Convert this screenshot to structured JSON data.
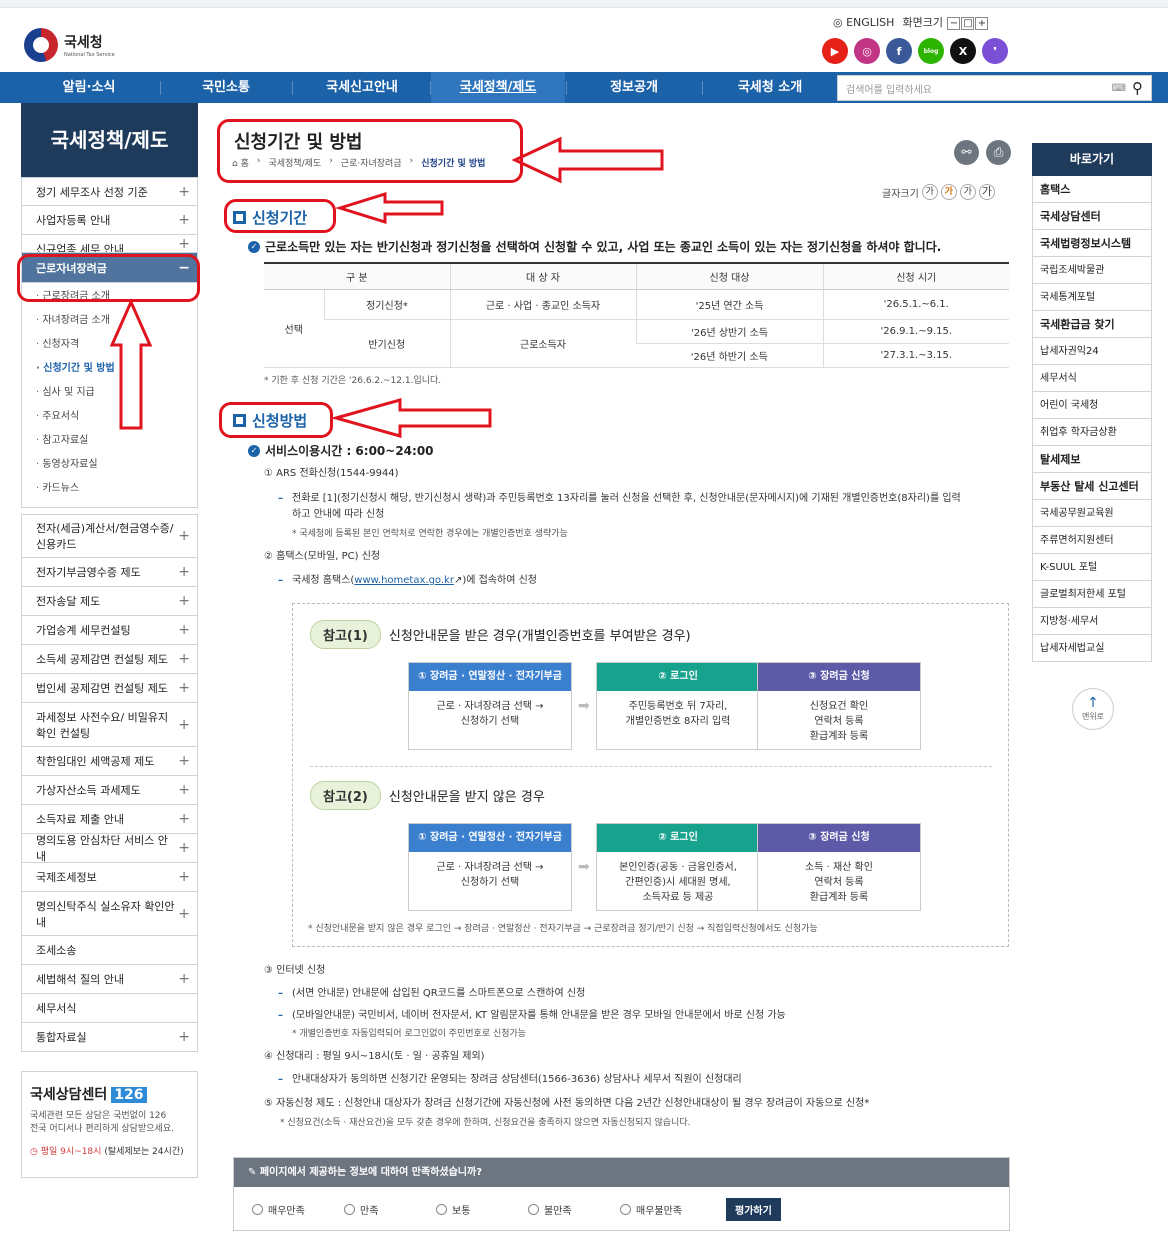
{
  "header": {
    "logo_text": "국세청",
    "logo_sub": "National Tax Service",
    "lang": "ENGLISH",
    "zoom_label": "화면크기",
    "zoom_minus": "−",
    "zoom_reset": "□",
    "zoom_plus": "+",
    "sns": [
      {
        "name": "youtube",
        "glyph": "▶",
        "color": "#e62117"
      },
      {
        "name": "instagram",
        "glyph": "◎",
        "color": "#c13584"
      },
      {
        "name": "facebook",
        "glyph": "f",
        "color": "#3b5998"
      },
      {
        "name": "blog",
        "glyph": "blog",
        "color": "#2db400"
      },
      {
        "name": "x",
        "glyph": "X",
        "color": "#111111"
      },
      {
        "name": "kakao",
        "glyph": "❜",
        "color": "#7b4fd6"
      }
    ]
  },
  "gnb": {
    "items": [
      "알림·소식",
      "국민소통",
      "국세신고안내",
      "국세정책/제도",
      "정보공개",
      "국세청 소개"
    ],
    "active": "국세정책/제도",
    "search_placeholder": "검색어를 입력하세요"
  },
  "lnb": {
    "title": "국세정책/제도",
    "top_items": [
      "정기 세무조사 선정 기준",
      "사업자등록 안내",
      "신규업종 세무 안내"
    ],
    "active": "근로자녀장려금",
    "subs": [
      "근로장려금 소개",
      "자녀장려금 소개",
      "신청자격",
      "신청기간 및 방법",
      "심사 및 지급",
      "주요서식",
      "참고자료실",
      "동영상자료실",
      "카드뉴스"
    ],
    "active_sub": "신청기간 및 방법",
    "items": [
      "전자(세금)계산서/현금영수증/신용카드",
      "전자기부금영수증 제도",
      "전자송달 제도",
      "가업승계 세무컨설팅",
      "소득세 공제감면 컨설팅 제도",
      "법인세 공제감면 컨설팅 제도",
      "과세정보 사전수요/ 비밀유지 확인 컨설팅",
      "착한임대인 세액공제 제도",
      "가상자산소득 과세제도",
      "소득자료 제출 안내",
      "명의도용 안심차단 서비스 안내",
      "국제조세정보",
      "명의신탁주식 실소유자 확인안내",
      "조세소송",
      "세법해석 질의 안내",
      "세무서식",
      "통합자료실"
    ]
  },
  "counsel": {
    "title": "국세상담센터",
    "number": "126",
    "desc1": "국세관련 모든 상담은 국번없이 126",
    "desc2": "전국 어디서나 편리하게 상담받으세요.",
    "hours_red": "평일 9시~18시",
    "hours_rest": "(탈세제보는 24시간)"
  },
  "page": {
    "title": "신청기간 및 방법",
    "breadcrumb": [
      "홈",
      "국세정책/제도",
      "근로·자녀장려금",
      "신청기간 및 방법"
    ],
    "font_label": "글자크기",
    "font_btns": [
      "가",
      "가",
      "가",
      "가"
    ],
    "sec1": "신청기간",
    "sec1_lead": "근로소득만 있는 자는 반기신청과 정기신청을 선택하여 신청할 수 있고, 사업 또는 종교인 소득이 있는 자는 정기신청을 하셔야 합니다.",
    "table": {
      "headers": [
        "구 분",
        "대 상 자",
        "신청 대상",
        "신청 시기"
      ],
      "group": "선택",
      "r1": [
        "정기신청*",
        "근로 · 사업 · 종교인 소득자",
        "'25년 연간 소득",
        "'26.5.1.~6.1."
      ],
      "r2": [
        "반기신청",
        "근로소득자",
        "'26년 상반기 소득",
        "'26.9.1.~9.15."
      ],
      "r3": [
        "'26년 하반기 소득",
        "'27.3.1.~3.15."
      ]
    },
    "table_note": "* 기한 후 신청 기간은 '26.6.2.~12.1.입니다.",
    "sec2": "신청방법",
    "service_hours": "서비스이용시간 : 6:00~24:00",
    "m1": "① ARS 전화신청(1544-9944)",
    "m1_d1": "전화로 [1](정기신청시 해당, 반기신청시 생략)과 주민등록번호 13자리를 눌러 신청을 선택한 후, 신청안내문(문자메시지)에 기재된 개별인증번호(8자리)를 입력",
    "m1_d2": "하고 안내에 따라 신청",
    "m1_n": "* 국세청에 등록된 본인 연락처로 연락한 경우에는 개별인증번호 생략가능",
    "m2": "② 홈택스(모바일, PC) 신청",
    "m2_d1": "국세청 홈택스(",
    "m2_link": "www.hometax.go.kr",
    "m2_d2": "↗)에 접속하여 신청",
    "ref1_pill": "참고(1)",
    "ref1_title": "신청안내문을 받은 경우(개별인증번호를 부여받은 경우)",
    "ref2_pill": "참고(2)",
    "ref2_title": "신청안내문을 받지 않은 경우",
    "steps1": [
      {
        "head": "① 장려금 · 연말정산 · 전자기부금",
        "l1": "근로 · 자녀장려금 선택 →",
        "l2": "신청하기 선택",
        "l3": ""
      },
      {
        "head": "② 로그인",
        "l1": "주민등록번호 뒤 7자리,",
        "l2": "개별인증번호 8자리 입력",
        "l3": ""
      },
      {
        "head": "③ 장려금 신청",
        "l1": "신청요건 확인",
        "l2": "연락처 등록",
        "l3": "환급계좌 등록"
      }
    ],
    "steps2": [
      {
        "head": "① 장려금 · 연말정산 · 전자기부금",
        "l1": "근로 · 자녀장려금 선택 →",
        "l2": "신청하기 선택",
        "l3": ""
      },
      {
        "head": "② 로그인",
        "l1": "본인인증(공동 · 금융인증서,",
        "l2": "간편인증)시 세대원 명세,",
        "l3": "소득자료 등 제공"
      },
      {
        "head": "③ 장려금 신청",
        "l1": "소득 · 재산 확인",
        "l2": "연락처 등록",
        "l3": "환급계좌 등록"
      }
    ],
    "steps_note": "* 신청안내문을 받지 않은 경우 로그인 → 장려금 · 연말정산 · 전자기부금 → 근로장려금 정기/반기 신청 → 직접입력신청에서도 신청가능",
    "m3": "③ 인터넷 신청",
    "m3_d1": "(서면 안내문) 안내문에 삽입된 QR코드를 스마트폰으로 스캔하여 신청",
    "m3_d2": "(모바일안내문) 국민비서, 네이버 전자문서, KT 알림문자를 통해 안내문을 받은 경우 모바일 안내문에서 바로 신청 가능",
    "m3_n": "* 개별인증번호 자동입력되어 로그인없이 주민번호로 신청가능",
    "m4": "④ 신청대리 : 평일 9시~18시(토 · 일 · 공휴일 제외)",
    "m4_d1": "안내대상자가 동의하면 신청기간 운영되는 장려금 상담센터(1566-3636) 상담사나 세무서 직원이 신청대리",
    "m5": "⑤ 자동신청 제도 : 신청안내 대상자가 장려금 신청기간에 자동신청에 사전 동의하면 다음 2년간 신청안내대상이 될 경우 장려금이 자동으로 신청*",
    "m5_n": "* 신청요건(소득 · 재산요건)을 모두 갖춘 경우에 한하며, 신청요건을 충족하지 않으면 자동신청되지 않습니다."
  },
  "survey": {
    "question": "페이지에서 제공하는 정보에 대하여 만족하셨습니까?",
    "options": [
      "매우만족",
      "만족",
      "보통",
      "불만족",
      "매우불만족"
    ],
    "submit": "평가하기"
  },
  "quick": {
    "title": "바로가기",
    "items": [
      "홈택스",
      "국세상담센터",
      "국세법령정보시스템",
      "국립조세박물관",
      "국세통계포털",
      "국세환급금 찾기",
      "납세자권익24",
      "세무서식",
      "어린이 국세청",
      "취업후 학자금상환",
      "탈세제보",
      "부동산 탈세 신고센터",
      "국세공무원교육원",
      "주류면허지원센터",
      "K-SUUL 포털",
      "글로벌최저한세 포털",
      "지방청·세무서",
      "납세자세법교실"
    ],
    "bold": [
      "홈택스",
      "국세상담센터",
      "국세법령정보시스템",
      "국세환급금 찾기",
      "탈세제보",
      "부동산 탈세 신고센터"
    ],
    "top": "맨위로"
  }
}
